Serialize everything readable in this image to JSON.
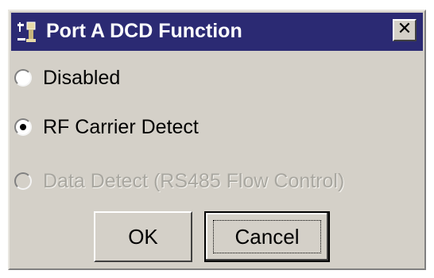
{
  "window": {
    "title": "Port A DCD Function",
    "close_label": "✕",
    "titlebar_color": "#2b2a73",
    "face_color": "#d4d0c8"
  },
  "options": [
    {
      "label": "Disabled",
      "checked": false,
      "enabled": true
    },
    {
      "label": "RF Carrier Detect",
      "checked": true,
      "enabled": true
    },
    {
      "label": "Data Detect (RS485 Flow Control)",
      "checked": false,
      "enabled": false
    }
  ],
  "buttons": {
    "ok_label": "OK",
    "cancel_label": "Cancel"
  },
  "icons": {
    "title_icon": "app-plug-icon",
    "close_icon": "close-icon"
  }
}
